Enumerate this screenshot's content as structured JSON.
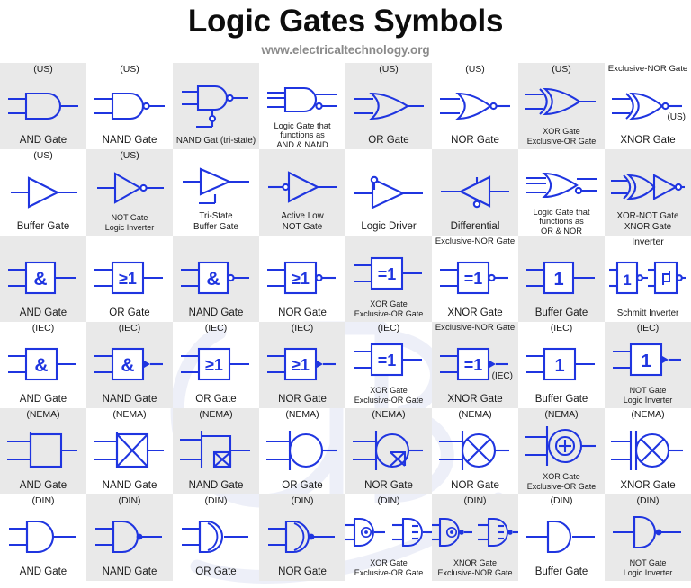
{
  "header": {
    "title": "Logic Gates Symbols",
    "subtitle": "www.electricaltechnology.org"
  },
  "colors": {
    "symbol_blue": "#1f35e0",
    "cell_shaded": "#e9e9e9",
    "cell_plain": "#ffffff",
    "text": "#1a1a1a",
    "subtitle_gray": "#8a8a8a",
    "watermark": "#dfe2f2"
  },
  "grid": {
    "columns": 8,
    "rows": 6,
    "cells": [
      {
        "row": 1,
        "col": 1,
        "shade": "shaded",
        "top": "(US)",
        "caption": "AND Gate",
        "icon": "and-gate-us"
      },
      {
        "row": 1,
        "col": 2,
        "shade": "plain",
        "top": "(US)",
        "caption": "NAND Gate",
        "icon": "nand-gate-us"
      },
      {
        "row": 1,
        "col": 3,
        "shade": "shaded",
        "top": "",
        "caption": "NAND Gat (tri-state)",
        "icon": "nand-gate-tristate"
      },
      {
        "row": 1,
        "col": 4,
        "shade": "plain",
        "top": "",
        "caption": "",
        "midcap": "Logic Gate that\nfunctions as\nAND & NAND",
        "icon": "and-nand-combined"
      },
      {
        "row": 1,
        "col": 5,
        "shade": "shaded",
        "top": "(US)",
        "caption": "OR Gate",
        "icon": "or-gate-us"
      },
      {
        "row": 1,
        "col": 6,
        "shade": "plain",
        "top": "(US)",
        "caption": "NOR Gate",
        "icon": "nor-gate-us"
      },
      {
        "row": 1,
        "col": 7,
        "shade": "shaded",
        "top": "(US)",
        "caption": "XOR Gate\nExclusive-OR Gate",
        "icon": "xor-gate-us"
      },
      {
        "row": 1,
        "col": 8,
        "shade": "plain",
        "top": "Exclusive-NOR Gate",
        "caption": "XNOR Gate",
        "subnote": "(US)",
        "icon": "xnor-gate-us"
      },
      {
        "row": 2,
        "col": 1,
        "shade": "plain",
        "top": "(US)",
        "caption": "Buffer Gate",
        "icon": "buffer-gate-us"
      },
      {
        "row": 2,
        "col": 2,
        "shade": "shaded",
        "top": "(US)",
        "caption": "NOT Gate\nLogic Inverter",
        "icon": "not-gate-us"
      },
      {
        "row": 2,
        "col": 3,
        "shade": "plain",
        "top": "",
        "caption": "Tri-State\nBuffer Gate",
        "icon": "tristate-buffer-gate"
      },
      {
        "row": 2,
        "col": 4,
        "shade": "shaded",
        "top": "",
        "caption": "Active Low\nNOT Gate",
        "icon": "active-low-not-gate"
      },
      {
        "row": 2,
        "col": 5,
        "shade": "plain",
        "top": "",
        "caption": "Logic Driver",
        "icon": "logic-driver"
      },
      {
        "row": 2,
        "col": 6,
        "shade": "shaded",
        "top": "",
        "caption": "Differential",
        "icon": "differential"
      },
      {
        "row": 2,
        "col": 7,
        "shade": "plain",
        "top": "",
        "caption": "",
        "midcap": "Logic Gate that\nfunctions as\nOR & NOR",
        "icon": "or-nor-combined"
      },
      {
        "row": 2,
        "col": 8,
        "shade": "shaded",
        "top": "",
        "caption": "XOR-NOT Gate\nXNOR Gate",
        "icon": "xor-not-gate"
      },
      {
        "row": 3,
        "col": 1,
        "shade": "shaded",
        "top": "",
        "caption": "AND Gate",
        "icon": "and-gate-rect-amp"
      },
      {
        "row": 3,
        "col": 2,
        "shade": "plain",
        "top": "",
        "caption": "OR Gate",
        "icon": "or-gate-rect-ge1"
      },
      {
        "row": 3,
        "col": 3,
        "shade": "shaded",
        "top": "",
        "caption": "NAND Gate",
        "icon": "nand-gate-rect-amp"
      },
      {
        "row": 3,
        "col": 4,
        "shade": "plain",
        "top": "",
        "caption": "NOR Gate",
        "icon": "nor-gate-rect-ge1"
      },
      {
        "row": 3,
        "col": 5,
        "shade": "shaded",
        "top": "",
        "caption": "XOR Gate\nExclusive-OR Gate",
        "icon": "xor-gate-rect-eq1"
      },
      {
        "row": 3,
        "col": 6,
        "shade": "plain",
        "top": "Exclusive-NOR Gate",
        "caption": "XNOR Gate",
        "icon": "xnor-gate-rect-eq1"
      },
      {
        "row": 3,
        "col": 7,
        "shade": "shaded",
        "top": "",
        "caption": "Buffer Gate",
        "icon": "buffer-gate-rect-1"
      },
      {
        "row": 3,
        "col": 8,
        "shade": "plain",
        "top": "Inverter",
        "caption": "Schmitt Inverter",
        "icon": "schmitt-inverter"
      },
      {
        "row": 4,
        "col": 1,
        "shade": "plain",
        "top": "(IEC)",
        "caption": "AND Gate",
        "icon": "iec-and-gate"
      },
      {
        "row": 4,
        "col": 2,
        "shade": "shaded",
        "top": "(IEC)",
        "caption": "NAND Gate",
        "icon": "iec-nand-gate"
      },
      {
        "row": 4,
        "col": 3,
        "shade": "plain",
        "top": "(IEC)",
        "caption": "OR Gate",
        "icon": "iec-or-gate"
      },
      {
        "row": 4,
        "col": 4,
        "shade": "shaded",
        "top": "(IEC)",
        "caption": "NOR Gate",
        "icon": "iec-nor-gate"
      },
      {
        "row": 4,
        "col": 5,
        "shade": "plain",
        "top": "(IEC)",
        "caption": "XOR Gate\nExclusive-OR Gate",
        "icon": "iec-xor-gate"
      },
      {
        "row": 4,
        "col": 6,
        "shade": "shaded",
        "top": "Exclusive-NOR Gate",
        "caption": "XNOR Gate",
        "subnote": "(IEC)",
        "icon": "iec-xnor-gate"
      },
      {
        "row": 4,
        "col": 7,
        "shade": "plain",
        "top": "(IEC)",
        "caption": "Buffer Gate",
        "icon": "iec-buffer-gate"
      },
      {
        "row": 4,
        "col": 8,
        "shade": "shaded",
        "top": "(IEC)",
        "caption": "NOT Gate\nLogic Inverter",
        "icon": "iec-not-gate"
      },
      {
        "row": 5,
        "col": 1,
        "shade": "shaded",
        "top": "(NEMA)",
        "caption": "AND Gate",
        "icon": "nema-and-gate"
      },
      {
        "row": 5,
        "col": 2,
        "shade": "plain",
        "top": "(NEMA)",
        "caption": "NAND Gate",
        "icon": "nema-nand-gate"
      },
      {
        "row": 5,
        "col": 3,
        "shade": "shaded",
        "top": "(NEMA)",
        "caption": "NAND Gate",
        "icon": "nema-nand-gate-alt"
      },
      {
        "row": 5,
        "col": 4,
        "shade": "plain",
        "top": "(NEMA)",
        "caption": "OR Gate",
        "icon": "nema-or-gate"
      },
      {
        "row": 5,
        "col": 5,
        "shade": "shaded",
        "top": "(NEMA)",
        "caption": "NOR Gate",
        "icon": "nema-nor-gate"
      },
      {
        "row": 5,
        "col": 6,
        "shade": "plain",
        "top": "(NEMA)",
        "caption": "NOR Gate",
        "icon": "nema-nor-gate-alt"
      },
      {
        "row": 5,
        "col": 7,
        "shade": "shaded",
        "top": "(NEMA)",
        "caption": "XOR Gate\nExclusive-OR Gate",
        "icon": "nema-xor-gate"
      },
      {
        "row": 5,
        "col": 8,
        "shade": "plain",
        "top": "(NEMA)",
        "caption": "XNOR Gate",
        "icon": "nema-xnor-gate"
      },
      {
        "row": 6,
        "col": 1,
        "shade": "plain",
        "top": "(DIN)",
        "caption": "AND Gate",
        "icon": "din-and-gate"
      },
      {
        "row": 6,
        "col": 2,
        "shade": "shaded",
        "top": "(DIN)",
        "caption": "NAND Gate",
        "icon": "din-nand-gate"
      },
      {
        "row": 6,
        "col": 3,
        "shade": "plain",
        "top": "(DIN)",
        "caption": "OR Gate",
        "icon": "din-or-gate"
      },
      {
        "row": 6,
        "col": 4,
        "shade": "shaded",
        "top": "(DIN)",
        "caption": "NOR Gate",
        "icon": "din-nor-gate"
      },
      {
        "row": 6,
        "col": 5,
        "shade": "plain",
        "top": "(DIN)",
        "caption": "XOR Gate\nExclusive-OR Gate",
        "icon": "din-xor-gate"
      },
      {
        "row": 6,
        "col": 6,
        "shade": "shaded",
        "top": "(DIN)",
        "caption": "XNOR Gate\nExclusive-NOR Gate",
        "icon": "din-xnor-gate"
      },
      {
        "row": 6,
        "col": 7,
        "shade": "plain",
        "top": "(DIN)",
        "caption": "Buffer Gate",
        "icon": "din-buffer-gate"
      },
      {
        "row": 6,
        "col": 8,
        "shade": "shaded",
        "top": "(DIN)",
        "caption": "NOT Gate\nLogic Inverter",
        "icon": "din-not-gate"
      }
    ]
  }
}
